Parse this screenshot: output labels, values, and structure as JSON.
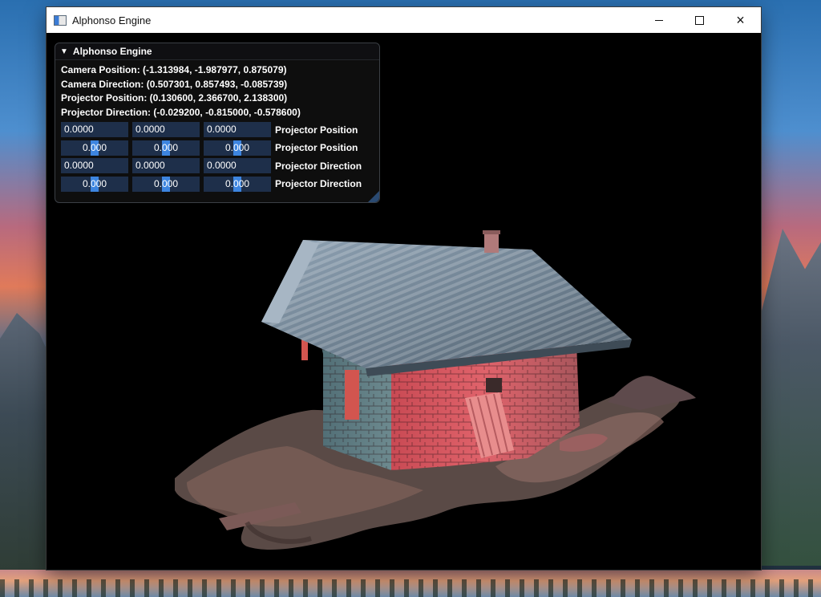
{
  "window": {
    "title": "Alphonso Engine",
    "controls": {
      "minimize": "minimize",
      "maximize": "maximize",
      "close": "×"
    }
  },
  "panel": {
    "header": "Alphonso Engine",
    "info": {
      "camera_position": "Camera Position: (-1.313984, -1.987977, 0.875079)",
      "camera_direction": "Camera Direction: (0.507301, 0.857493, -0.085739)",
      "projector_position": "Projector Position: (0.130600, 2.366700, 2.138300)",
      "projector_direction": "Projector Direction: (-0.029200, -0.815000, -0.578600)"
    },
    "rows": [
      {
        "type": "input",
        "values": [
          "0.0000",
          "0.0000",
          "0.0000"
        ],
        "label": "Projector Position"
      },
      {
        "type": "drag",
        "values": [
          "0.000",
          "0.000",
          "0.000"
        ],
        "label": "Projector Position"
      },
      {
        "type": "input",
        "values": [
          "0.0000",
          "0.0000",
          "0.0000"
        ],
        "label": "Projector Direction"
      },
      {
        "type": "drag",
        "values": [
          "0.000",
          "0.000",
          "0.000"
        ],
        "label": "Projector Direction"
      }
    ]
  },
  "icons": {
    "app": "app-window-icon",
    "collapse": "collapse-arrow-icon",
    "resize": "resize-grip-icon"
  },
  "colors": {
    "field_bg": "#1e2f4a",
    "slider_grab": "#3d85e0",
    "panel_bg": "#0f0f0f"
  }
}
